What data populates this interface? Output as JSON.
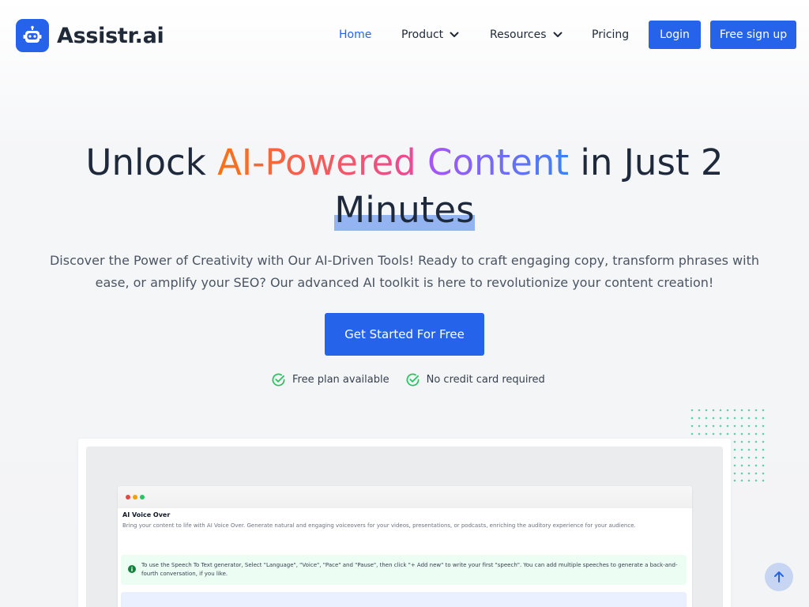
{
  "brand": {
    "name": "Assistr.ai",
    "accent": "#2563eb"
  },
  "nav": {
    "home": "Home",
    "product": "Product",
    "resources": "Resources",
    "pricing": "Pricing",
    "login": "Login",
    "signup": "Free sign up"
  },
  "hero": {
    "title_part1": "Unlock ",
    "title_highlight1": "AI-Powered",
    "title_space": " ",
    "title_highlight2": "Content",
    "title_part2": " in Just 2",
    "title_part3": "Minutes",
    "subtitle": "Discover the Power of Creativity with Our AI-Driven Tools! Ready to craft engaging copy, transform phrases with ease, or amplify your SEO? Our advanced AI toolkit is here to revolutionize your content creation!",
    "cta": "Get Started For Free",
    "perks": [
      "Free plan available",
      "No credit card required"
    ]
  },
  "preview": {
    "title": "AI Voice Over",
    "description": "Bring your content to life with AI Voice Over. Generate natural and engaging voiceovers for your videos, presentations, or podcasts, enriching the auditory experience for your audience.",
    "info": "To use the Speech To Text generator, Select \"Language\", \"Voice\", \"Pace\" and \"Pause\", then click \"+ Add new\" to write your first \"speech\". You can add multiple speeches to generate a back-and-fourth conversation, if you like."
  },
  "icons": {
    "logo": "robot-icon",
    "chevron": "chevron-down-icon",
    "check": "check-circle-icon",
    "info": "info-icon",
    "scroll": "arrow-up-icon"
  }
}
